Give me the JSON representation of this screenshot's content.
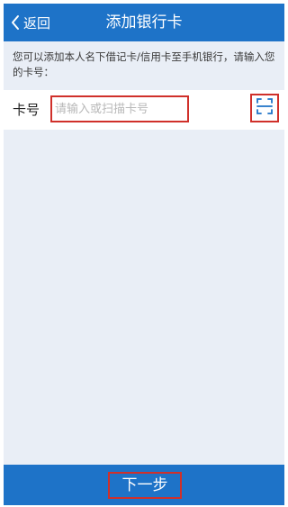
{
  "header": {
    "back_label": "返回",
    "title": "添加银行卡"
  },
  "hint": "您可以添加本人名下借记卡/信用卡至手机银行，请输入您的卡号：",
  "card_row": {
    "label": "卡号",
    "placeholder": "请输入或扫描卡号",
    "scan_icon": "scan-icon"
  },
  "footer": {
    "next_label": "下一步"
  },
  "colors": {
    "brand_blue": "#1e73c8",
    "highlight_red": "#d0302a",
    "page_bg": "#e9eef6"
  }
}
